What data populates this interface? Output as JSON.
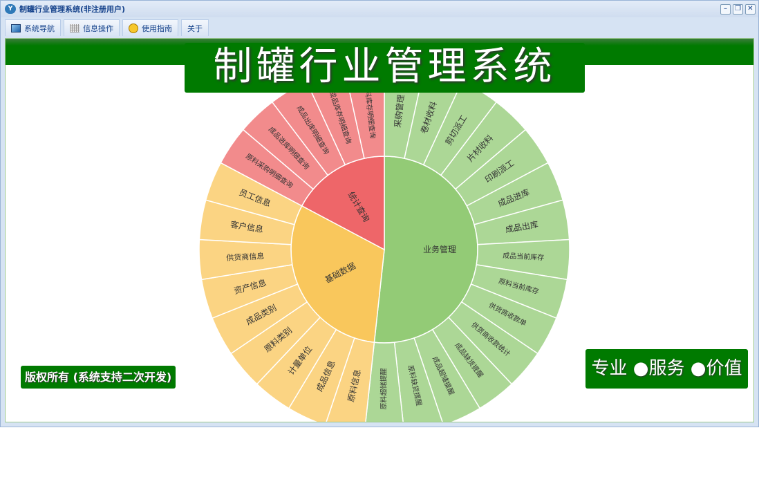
{
  "window": {
    "title": "制罐行业管理系统(非注册用户)",
    "app_icon": "Y"
  },
  "tabs": [
    {
      "label": "系统导航",
      "icon": "monitor-icon"
    },
    {
      "label": "信息操作",
      "icon": "grid-icon"
    },
    {
      "label": "使用指南",
      "icon": "help-icon"
    },
    {
      "label": "关于"
    }
  ],
  "banner": {
    "title": "制罐行业管理系统"
  },
  "copyright": "版权所有 (系统支持二次开发)",
  "slogan": "专业 ●服务 ●价值",
  "colors": {
    "green": "#93cb76",
    "green_light": "#acd796",
    "yellow": "#f9c75c",
    "yellow_light": "#fbd483",
    "red": "#ee6669",
    "red_light": "#f28b8c",
    "brand": "#007a00"
  },
  "chart_data": {
    "type": "sunburst",
    "groups": [
      {
        "name": "业务管理",
        "color": "#93cb76",
        "light": "#acd796",
        "children": [
          "采购管理",
          "卷材收料",
          "剪切派工",
          "片材收料",
          "印刷派工",
          "成品进库",
          "成品出库",
          "成品当前库存",
          "原料当前库存",
          "供货商收款单",
          "供货商收款统计",
          "成品缺货提醒",
          "成品超储提醒",
          "原料缺货提醒",
          "原料超储提醒"
        ]
      },
      {
        "name": "基础数据",
        "color": "#f9c75c",
        "light": "#fbd483",
        "children": [
          "原料信息",
          "成品信息",
          "计量单位",
          "原料类别",
          "成品类别",
          "资产信息",
          "供货商信息",
          "客户信息",
          "员工信息"
        ]
      },
      {
        "name": "统计查询",
        "color": "#ee6669",
        "light": "#f28b8c",
        "children": [
          "原料采购明细查询",
          "成品进库明细查询",
          "成品出库明细查询",
          "成品库存明细查询",
          "原料库存明细查询"
        ]
      }
    ]
  }
}
